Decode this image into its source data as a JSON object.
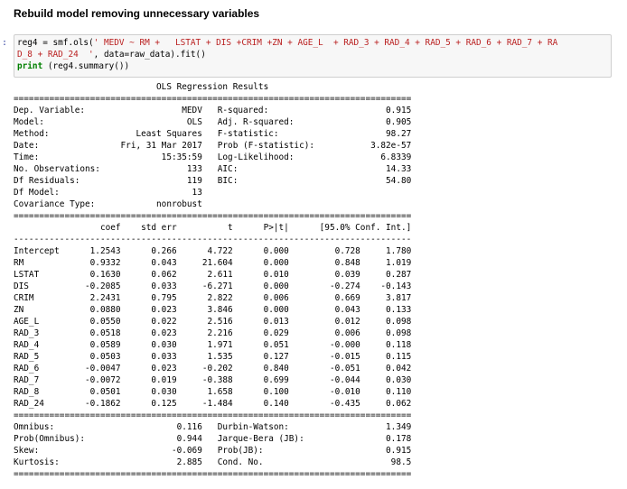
{
  "cell_heading": "Rebuild model removing unnecessary variables",
  "input": {
    "prompt": ":",
    "code_lines": [
      {
        "pre": "reg4 = smf.ols(",
        "str": "' MEDV ~ RM +   LSTAT + DIS +CRIM +ZN + AGE_L  + RAD_3 + RAD_4 + RAD_5 + RAD_6 + RAD_7 + RA",
        "post": ""
      },
      {
        "pre": "",
        "str": "D_8 + RAD_24  '",
        "post": ", data=raw_data).fit()"
      },
      {
        "kw": "print",
        "post": " (reg4.summary())"
      }
    ]
  },
  "output_lines": [
    "                            OLS Regression Results                            ",
    "==============================================================================",
    "Dep. Variable:                   MEDV   R-squared:                       0.915",
    "Model:                            OLS   Adj. R-squared:                  0.905",
    "Method:                 Least Squares   F-statistic:                     98.27",
    "Date:                Fri, 31 Mar 2017   Prob (F-statistic):           3.82e-57",
    "Time:                        15:35:59   Log-Likelihood:                 6.8339",
    "No. Observations:                 133   AIC:                             14.33",
    "Df Residuals:                     119   BIC:                             54.80",
    "Df Model:                          13                                         ",
    "Covariance Type:            nonrobust                                         ",
    "==============================================================================",
    "                 coef    std err          t      P>|t|      [95.0% Conf. Int.]",
    "------------------------------------------------------------------------------",
    "Intercept      1.2543      0.266      4.722      0.000         0.728     1.780",
    "RM             0.9332      0.043     21.604      0.000         0.848     1.019",
    "LSTAT          0.1630      0.062      2.611      0.010         0.039     0.287",
    "DIS           -0.2085      0.033     -6.271      0.000        -0.274    -0.143",
    "CRIM           2.2431      0.795      2.822      0.006         0.669     3.817",
    "ZN             0.0880      0.023      3.846      0.000         0.043     0.133",
    "AGE_L          0.0550      0.022      2.516      0.013         0.012     0.098",
    "RAD_3          0.0518      0.023      2.216      0.029         0.006     0.098",
    "RAD_4          0.0589      0.030      1.971      0.051        -0.000     0.118",
    "RAD_5          0.0503      0.033      1.535      0.127        -0.015     0.115",
    "RAD_6         -0.0047      0.023     -0.202      0.840        -0.051     0.042",
    "RAD_7         -0.0072      0.019     -0.388      0.699        -0.044     0.030",
    "RAD_8          0.0501      0.030      1.658      0.100        -0.010     0.110",
    "RAD_24        -0.1862      0.125     -1.484      0.140        -0.435     0.062",
    "==============================================================================",
    "Omnibus:                        0.116   Durbin-Watson:                   1.349",
    "Prob(Omnibus):                  0.944   Jarque-Bera (JB):                0.178",
    "Skew:                          -0.069   Prob(JB):                        0.915",
    "Kurtosis:                       2.885   Cond. No.                         98.5",
    "=============================================================================="
  ]
}
